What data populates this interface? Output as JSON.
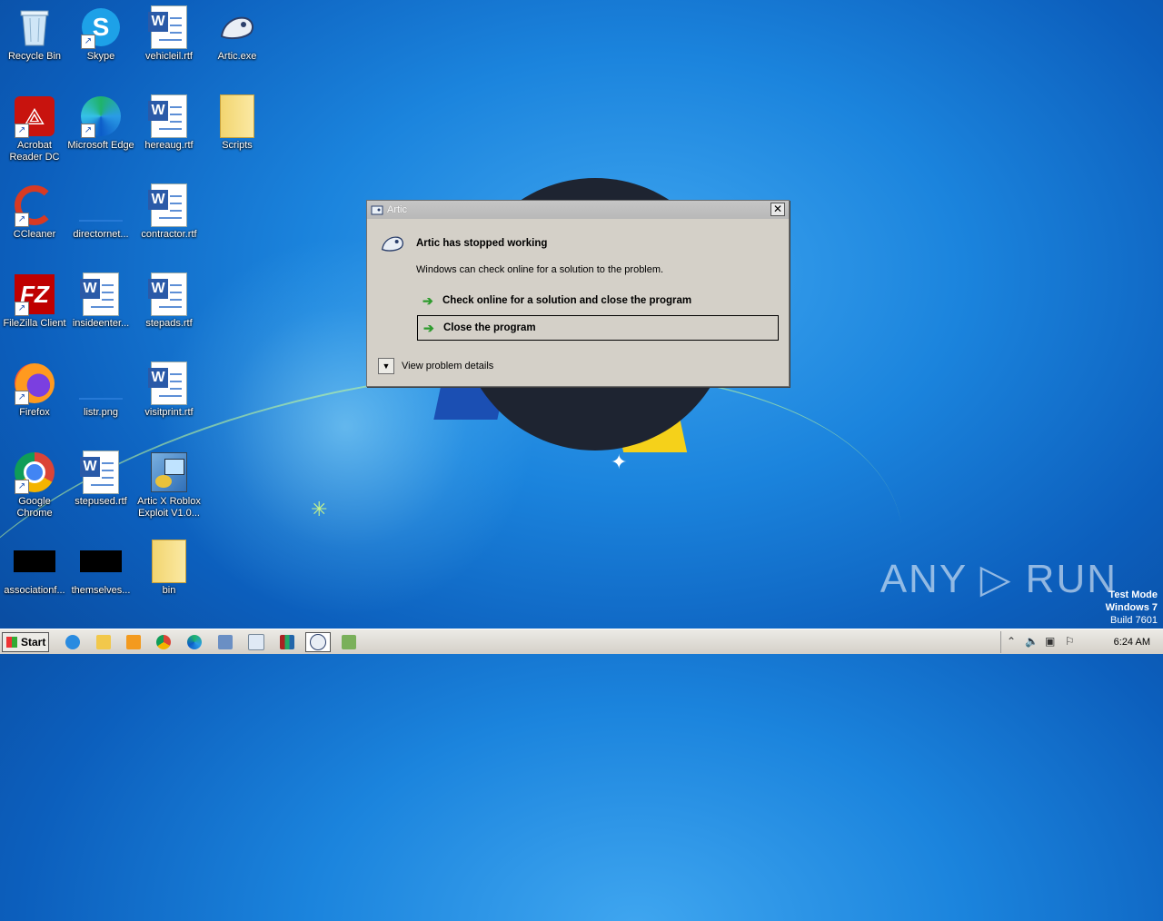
{
  "desktop": {
    "icons": [
      {
        "label": "Recycle Bin"
      },
      {
        "label": "Skype"
      },
      {
        "label": "vehicleil.rtf"
      },
      {
        "label": "Artic.exe"
      },
      {
        "label": "Acrobat Reader DC"
      },
      {
        "label": "Microsoft Edge"
      },
      {
        "label": "hereaug.rtf"
      },
      {
        "label": "Scripts"
      },
      {
        "label": "CCleaner"
      },
      {
        "label": "directornet..."
      },
      {
        "label": "contractor.rtf"
      },
      {
        "label": "FileZilla Client"
      },
      {
        "label": "insideenter..."
      },
      {
        "label": "stepads.rtf"
      },
      {
        "label": "Firefox"
      },
      {
        "label": "listr.png"
      },
      {
        "label": "visitprint.rtf"
      },
      {
        "label": "Google Chrome"
      },
      {
        "label": "stepused.rtf"
      },
      {
        "label": "Artic X Roblox Exploit V1.0..."
      },
      {
        "label": "associationf..."
      },
      {
        "label": "themselves..."
      },
      {
        "label": "bin"
      }
    ]
  },
  "dialog": {
    "title": "Artic",
    "close_glyph": "✕",
    "heading": "Artic has stopped working",
    "description": "Windows can check online for a solution to the problem.",
    "option_check": "Check online for a solution and close the program",
    "option_close": "Close the program",
    "details": "View problem details"
  },
  "watermark": {
    "brand": "ANY ▷ RUN",
    "test_mode": "Test Mode",
    "os": "Windows 7",
    "build": "Build 7601"
  },
  "taskbar": {
    "start_label": "Start",
    "clock": "6:24 AM"
  }
}
